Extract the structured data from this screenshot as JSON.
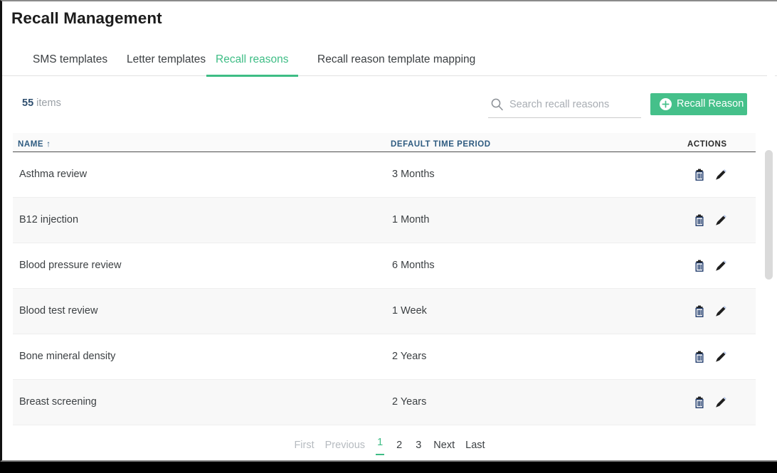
{
  "header": {
    "title": "Recall Management"
  },
  "tabs": [
    {
      "label": "SMS templates",
      "active": false
    },
    {
      "label": "Letter templates",
      "active": false
    },
    {
      "label": "Recall reasons",
      "active": true
    },
    {
      "label": "Recall reason template mapping",
      "active": false
    }
  ],
  "toolbar": {
    "item_count": "55",
    "item_count_label": "items",
    "search_placeholder": "Search recall reasons",
    "search_value": "",
    "search_icon": "search-icon",
    "add_button_label": "Recall Reason",
    "add_button_icon": "plus-circle-icon"
  },
  "table": {
    "columns": [
      "NAME",
      "DEFAULT TIME PERIOD",
      "ACTIONS"
    ],
    "sort_column": "NAME",
    "sort_indicator": "↑",
    "row_action_icons": [
      "trash-icon",
      "pencil-icon"
    ],
    "rows": [
      {
        "name": "Asthma review",
        "period": "3 Months"
      },
      {
        "name": "B12 injection",
        "period": "1 Month"
      },
      {
        "name": "Blood pressure review",
        "period": "6 Months"
      },
      {
        "name": "Blood test review",
        "period": "1 Week"
      },
      {
        "name": "Bone mineral density",
        "period": "2 Years"
      },
      {
        "name": "Breast screening",
        "period": "2 Years"
      }
    ]
  },
  "pagination": {
    "first": "First",
    "previous": "Previous",
    "pages": [
      "1",
      "2",
      "3"
    ],
    "current_page": "1",
    "next": "Next",
    "last": "Last"
  },
  "colors": {
    "accent_green": "#3ebd85",
    "button_green": "#45c08a",
    "header_blue": "#2e5b80",
    "muted_gray": "#9aa0a6"
  }
}
